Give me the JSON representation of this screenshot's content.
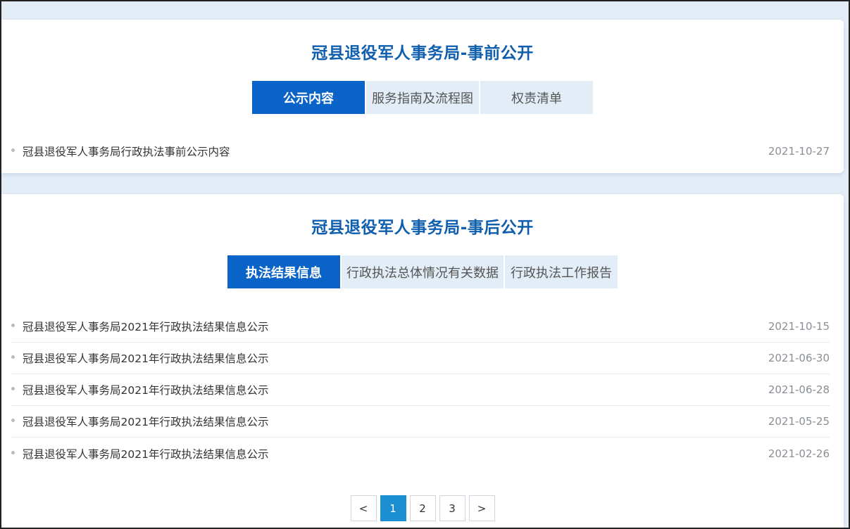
{
  "pre_section": {
    "title": "冠县退役军人事务局-事前公开",
    "tabs": [
      {
        "label": "公示内容",
        "active": true
      },
      {
        "label": "服务指南及流程图",
        "active": false
      },
      {
        "label": "权责清单",
        "active": false
      }
    ],
    "items": [
      {
        "title": "冠县退役军人事务局行政执法事前公示内容",
        "date": "2021-10-27"
      }
    ]
  },
  "post_section": {
    "title": "冠县退役军人事务局-事后公开",
    "tabs": [
      {
        "label": "执法结果信息",
        "active": true
      },
      {
        "label": "行政执法总体情况有关数据",
        "active": false
      },
      {
        "label": "行政执法工作报告",
        "active": false
      }
    ],
    "items": [
      {
        "title": "冠县退役军人事务局2021年行政执法结果信息公示",
        "date": "2021-10-15"
      },
      {
        "title": "冠县退役军人事务局2021年行政执法结果信息公示",
        "date": "2021-06-30"
      },
      {
        "title": "冠县退役军人事务局2021年行政执法结果信息公示",
        "date": "2021-06-28"
      },
      {
        "title": "冠县退役军人事务局2021年行政执法结果信息公示",
        "date": "2021-05-25"
      },
      {
        "title": "冠县退役军人事务局2021年行政执法结果信息公示",
        "date": "2021-02-26"
      }
    ]
  },
  "pagination": {
    "prev": "<",
    "pages": [
      "1",
      "2",
      "3"
    ],
    "current": "1",
    "next": ">"
  },
  "colors": {
    "accent": "#0a63c6",
    "title": "#0f5fae",
    "pager_active": "#1b8fd2",
    "background": "#e3edf8"
  }
}
